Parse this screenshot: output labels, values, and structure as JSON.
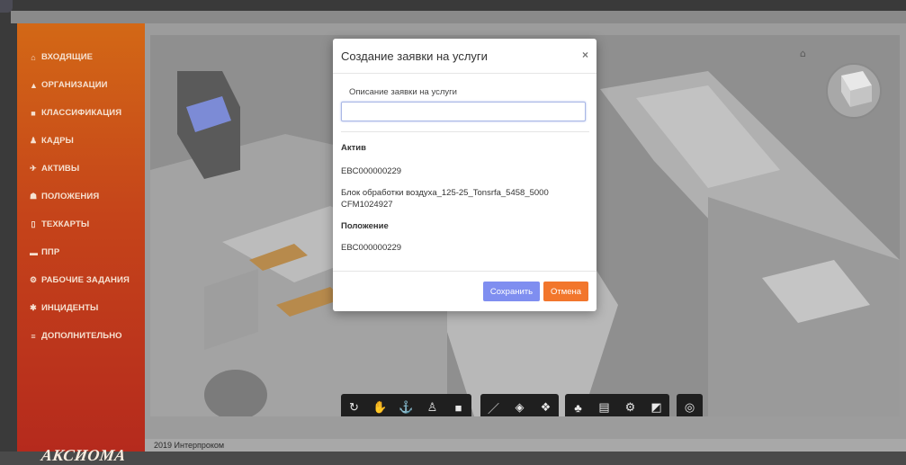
{
  "sidebar": {
    "items": [
      {
        "icon": "home-icon",
        "glyph": "⌂",
        "label": "ВХОДЯЩИЕ"
      },
      {
        "icon": "building-icon",
        "glyph": "▲",
        "label": "ОРГАНИЗАЦИИ"
      },
      {
        "icon": "book-icon",
        "glyph": "■",
        "label": "КЛАССИФИКАЦИЯ"
      },
      {
        "icon": "users-icon",
        "glyph": "♟",
        "label": "КАДРЫ"
      },
      {
        "icon": "plane-icon",
        "glyph": "✈",
        "label": "АКТИВЫ"
      },
      {
        "icon": "sitemap-icon",
        "glyph": "☗",
        "label": "ПОЛОЖЕНИЯ"
      },
      {
        "icon": "file-icon",
        "glyph": "▯",
        "label": "ТЕХКАРТЫ"
      },
      {
        "icon": "car-icon",
        "glyph": "▬",
        "label": "ППР"
      },
      {
        "icon": "gear-icon",
        "glyph": "⚙",
        "label": "РАБОЧИЕ ЗАДАНИЯ"
      },
      {
        "icon": "bug-icon",
        "glyph": "✱",
        "label": "ИНЦИДЕНТЫ"
      },
      {
        "icon": "menu-icon",
        "glyph": "≡",
        "label": "ДОПОЛНИТЕЛЬНО"
      }
    ],
    "logo_text": "АКСИОМА"
  },
  "footer": {
    "copyright": "2019 Интерпроком"
  },
  "viewer": {
    "toolbar_groups": [
      [
        "orbit-icon",
        "pan-icon",
        "zoom-icon",
        "walk-icon",
        "camera-icon"
      ],
      [
        "measure-icon",
        "section-icon",
        "explode-icon"
      ],
      [
        "model-tree-icon",
        "properties-icon",
        "settings-icon",
        "fullscreen-icon"
      ],
      [
        "focus-icon"
      ]
    ],
    "toolbar_glyphs": {
      "orbit-icon": "↻",
      "pan-icon": "✋",
      "zoom-icon": "⚓",
      "walk-icon": "♙",
      "camera-icon": "■",
      "measure-icon": "／",
      "section-icon": "◈",
      "explode-icon": "❖",
      "model-tree-icon": "♣",
      "properties-icon": "▤",
      "settings-icon": "⚙",
      "fullscreen-icon": "◩",
      "focus-icon": "◎"
    }
  },
  "modal": {
    "title": "Создание заявки на услуги",
    "close_glyph": "×",
    "description_label": "Описание заявки на услуги",
    "description_value": "",
    "asset_heading": "Актив",
    "asset_code": "EBC000000229",
    "asset_name": "Блок обработки воздуха_125-25_Tonsrfa_5458_5000 CFM1024927",
    "position_heading": "Положение",
    "position_code": "EBC000000229",
    "save_label": "Сохранить",
    "cancel_label": "Отмена"
  }
}
